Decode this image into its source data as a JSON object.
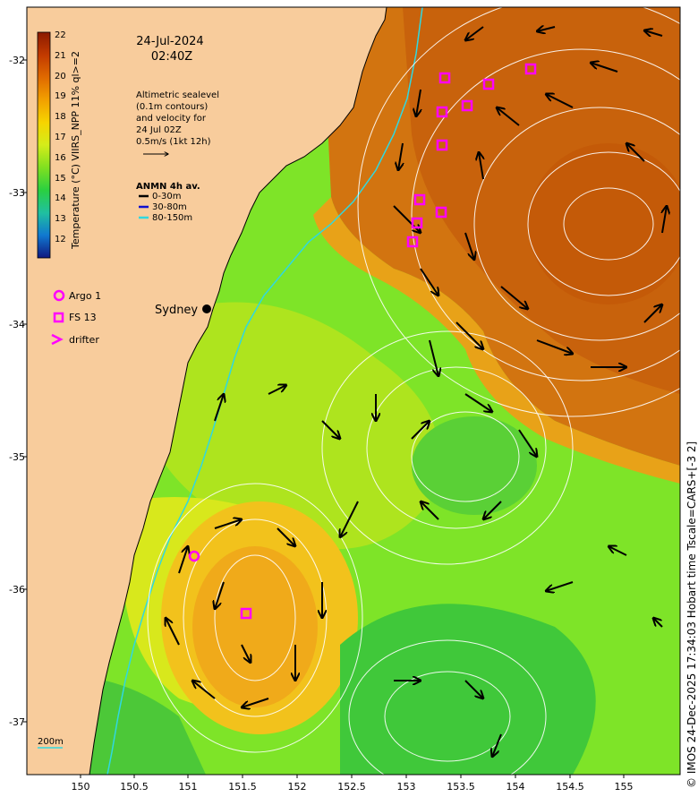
{
  "header": {
    "date": "24-Jul-2024",
    "time": "02:40Z"
  },
  "info_block": {
    "lines": [
      "Altimetric sealevel",
      "(0.1m contours)",
      "and velocity for",
      "24 Jul 02Z",
      "0.5m/s (1kt 12h)"
    ]
  },
  "anmn": {
    "title": "ANMN 4h av.",
    "items": [
      {
        "label": "0-30m",
        "color": "#000000"
      },
      {
        "label": "30-80m",
        "color": "#1010d0"
      },
      {
        "label": "80-150m",
        "color": "#30d8e0"
      }
    ]
  },
  "colorbar": {
    "title": "Temperature (°C) VIIRS_NPP 11% ql>=2",
    "ticks": [
      "22",
      "21",
      "20",
      "19",
      "18",
      "17",
      "16",
      "15",
      "14",
      "13",
      "12"
    ],
    "colors": [
      "#8b1a00",
      "#c23a00",
      "#e06a00",
      "#f2a000",
      "#f6d400",
      "#d4ec1a",
      "#80e020",
      "#2ad040",
      "#20c0a0",
      "#1078d0",
      "#1830b0",
      "#101880"
    ]
  },
  "markers_legend": [
    {
      "label": "Argo 1",
      "symbol": "circle",
      "color": "#ff00ff"
    },
    {
      "label": "FS 13",
      "symbol": "square",
      "color": "#ff00ff"
    },
    {
      "label": "drifter",
      "symbol": "chevron",
      "color": "#ff00ff"
    }
  ],
  "city": {
    "name": "Sydney"
  },
  "depth_label": "200m",
  "axes": {
    "x_ticks": [
      "150",
      "150.5",
      "151",
      "151.5",
      "152",
      "152.5",
      "153",
      "153.5",
      "154",
      "154.5",
      "155"
    ],
    "y_ticks": [
      "-32",
      "-33",
      "-34",
      "-35",
      "-36",
      "-37"
    ]
  },
  "credit": "© IMOS 24-Dec-2025 17:34:03 Hobart time Tscale=CARS+[-3 2]",
  "colors": {
    "land": "#f8cc9c",
    "warm": "#d27410",
    "warm_core": "#c45a08",
    "cool": "#7ee428",
    "mid": "#c8e41c",
    "eddy_core": "#f2b41c",
    "magenta": "#ff00ff"
  }
}
